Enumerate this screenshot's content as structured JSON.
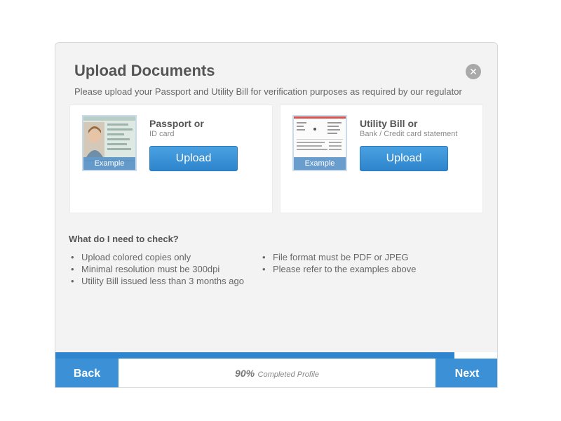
{
  "modal": {
    "title": "Upload Documents",
    "close_icon": "close-icon",
    "subtitle": "Please upload your Passport and Utility Bill for verification purposes as required by our regulator"
  },
  "cards": [
    {
      "title": "Passport or",
      "subtitle": "ID card",
      "example_label": "Example",
      "upload_label": "Upload",
      "thumbnail_icon": "passport-photo"
    },
    {
      "title": "Utility Bill or",
      "subtitle": "Bank / Credit card statement",
      "example_label": "Example",
      "upload_label": "Upload",
      "thumbnail_icon": "utility-bill-document"
    }
  ],
  "checklist": {
    "heading": "What do I need to check?",
    "column1": [
      "Upload colored copies only",
      "Minimal resolution must be 300dpi",
      "Utility Bill issued less than 3 months ago"
    ],
    "column2": [
      "File format must be PDF or JPEG",
      "Please refer to the examples above"
    ]
  },
  "footer": {
    "back_label": "Back",
    "next_label": "Next",
    "progress_percent_text": "90%",
    "progress_text": "Completed Profile",
    "progress_value": 0.9
  },
  "colors": {
    "accent": "#3c91d6",
    "button": "#2d84cc",
    "background": "#f3f3f3"
  }
}
